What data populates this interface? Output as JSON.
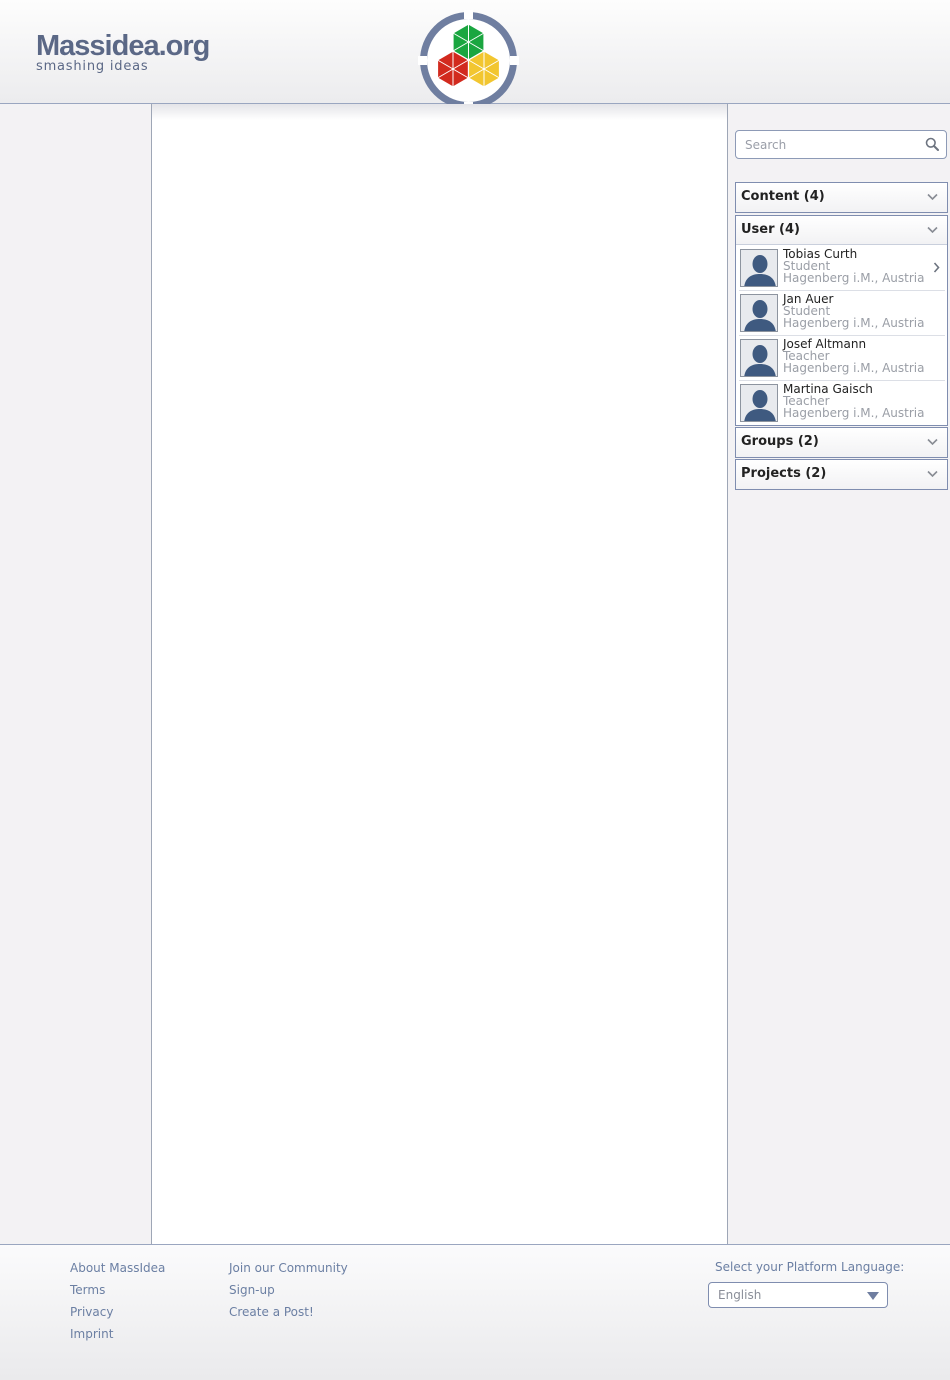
{
  "header": {
    "brand_name": "Massidea.org",
    "brand_tagline": "smashing ideas"
  },
  "search": {
    "placeholder": "Search",
    "icon": "search-icon"
  },
  "panels": {
    "content": {
      "label": "Content (4)"
    },
    "user": {
      "label": "User (4)"
    },
    "groups": {
      "label": "Groups (2)"
    },
    "projects": {
      "label": "Projects (2)"
    }
  },
  "users": [
    {
      "name": "Tobias Curth",
      "role": "Student",
      "location": "Hagenberg i.M., Austria"
    },
    {
      "name": "Jan Auer",
      "role": "Student",
      "location": "Hagenberg i.M., Austria"
    },
    {
      "name": "Josef Altmann",
      "role": "Teacher",
      "location": "Hagenberg i.M., Austria"
    },
    {
      "name": "Martina Gaisch",
      "role": "Teacher",
      "location": "Hagenberg i.M., Austria"
    }
  ],
  "footer": {
    "col1": [
      "About MassIdea",
      "Terms",
      "Privacy",
      "Imprint"
    ],
    "col2": [
      "Join our Community",
      "Sign-up",
      "Create a Post!"
    ],
    "language_label": "Select your Platform Language:",
    "language_value": "English"
  },
  "colors": {
    "accent": "#6b7fa3",
    "brand": "#5b6886",
    "border": "#7f8daf",
    "logo_green": "#1aa640",
    "logo_red": "#d22a1e",
    "logo_yellow": "#f2c630"
  }
}
